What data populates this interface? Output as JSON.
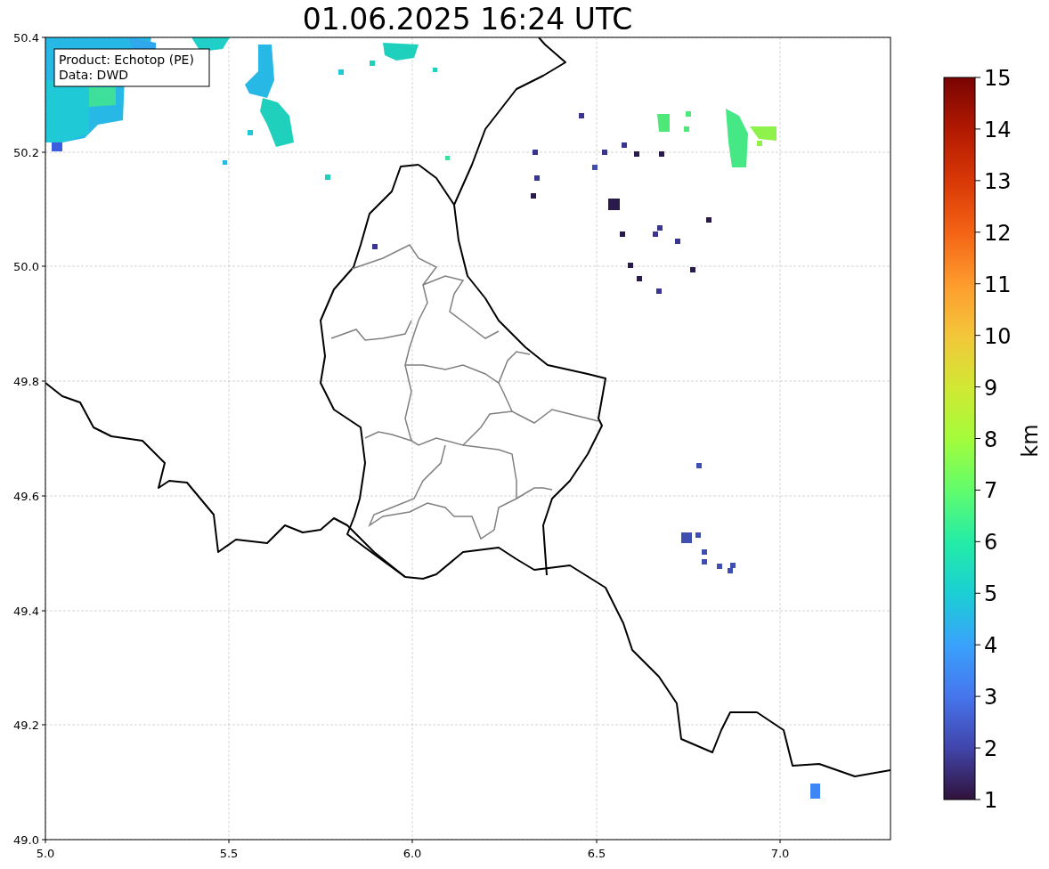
{
  "title": "01.06.2025 16:24 UTC",
  "info_box": {
    "lines": [
      "Product: Echotop (PE)",
      "Data: DWD"
    ]
  },
  "x_ticks": [
    "5.0",
    "5.5",
    "6.0",
    "6.5",
    "7.0"
  ],
  "y_ticks": [
    "50.4",
    "50.2",
    "50.0",
    "49.8",
    "49.6",
    "49.4",
    "49.2",
    "49.0"
  ],
  "colorbar": {
    "label": "km",
    "ticks": [
      "15",
      "14",
      "13",
      "12",
      "11",
      "10",
      "9",
      "8",
      "7",
      "6",
      "5",
      "4",
      "3",
      "2",
      "1"
    ]
  }
}
